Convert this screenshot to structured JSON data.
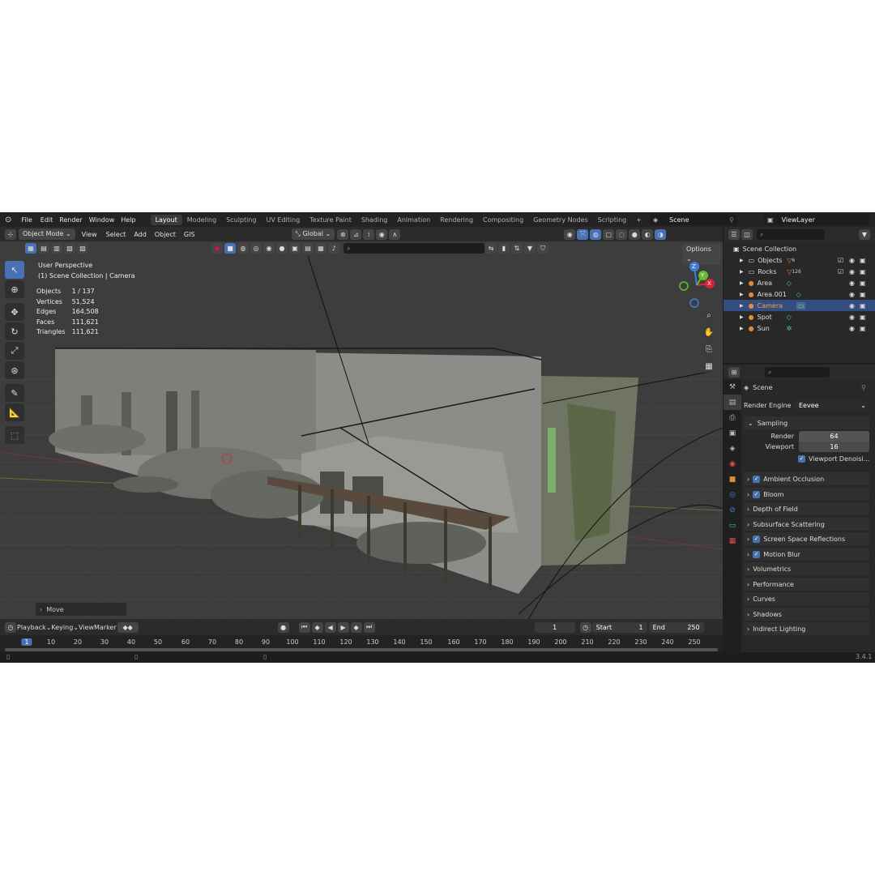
{
  "menus": [
    "File",
    "Edit",
    "Render",
    "Window",
    "Help"
  ],
  "workspaces": [
    "Layout",
    "Modeling",
    "Sculpting",
    "UV Editing",
    "Texture Paint",
    "Shading",
    "Animation",
    "Rendering",
    "Compositing",
    "Geometry Nodes",
    "Scripting"
  ],
  "active_workspace": "Layout",
  "add_workspace": "+",
  "scene_name": "Scene",
  "view_layer": "ViewLayer",
  "viewport_header": {
    "mode": "Object Mode",
    "menus": [
      "View",
      "Select",
      "Add",
      "Object",
      "GIS"
    ],
    "orientation": "Global",
    "options": "Options"
  },
  "viewport_overlay": {
    "perspective": "User Perspective",
    "collection": "(1) Scene Collection | Camera",
    "stats": [
      {
        "label": "Objects",
        "value": "1 / 137"
      },
      {
        "label": "Vertices",
        "value": "51,524"
      },
      {
        "label": "Edges",
        "value": "164,508"
      },
      {
        "label": "Faces",
        "value": "111,621"
      },
      {
        "label": "Triangles",
        "value": "111,621"
      }
    ],
    "last_op": "Move",
    "gizmo": {
      "z": "Z",
      "y": "Y",
      "x": "X"
    }
  },
  "timeline": {
    "menus": [
      "Playback",
      "Keying",
      "View",
      "Marker"
    ],
    "current_frame": "1",
    "start_label": "Start",
    "start": "1",
    "end_label": "End",
    "end": "250",
    "ruler_current": "1",
    "ruler": [
      "10",
      "20",
      "30",
      "40",
      "50",
      "60",
      "70",
      "80",
      "90",
      "100",
      "110",
      "120",
      "130",
      "140",
      "150",
      "160",
      "170",
      "180",
      "190",
      "200",
      "210",
      "220",
      "230",
      "240",
      "250"
    ]
  },
  "outliner": {
    "root": "Scene Collection",
    "items": [
      {
        "name": "Objects",
        "badge": "6",
        "checked": true,
        "selected": false
      },
      {
        "name": "Rocks",
        "badge": "126",
        "checked": true,
        "selected": false
      },
      {
        "name": "Area",
        "badge": "",
        "checked": false,
        "selected": false
      },
      {
        "name": "Area.001",
        "badge": "",
        "checked": false,
        "selected": false
      },
      {
        "name": "Camera",
        "badge": "",
        "checked": false,
        "selected": true
      },
      {
        "name": "Spot",
        "badge": "",
        "checked": false,
        "selected": false
      },
      {
        "name": "Sun",
        "badge": "",
        "checked": false,
        "selected": false
      }
    ]
  },
  "properties": {
    "title": "Scene",
    "render_engine_label": "Render Engine",
    "render_engine": "Eevee",
    "sampling": {
      "label": "Sampling",
      "render_label": "Render",
      "render": "64",
      "viewport_label": "Viewport",
      "viewport": "16",
      "denoise": "Viewport Denoisi..."
    },
    "panels": [
      {
        "label": "Ambient Occlusion",
        "checkbox": true
      },
      {
        "label": "Bloom",
        "checkbox": true
      },
      {
        "label": "Depth of Field",
        "checkbox": false
      },
      {
        "label": "Subsurface Scattering",
        "checkbox": false
      },
      {
        "label": "Screen Space Reflections",
        "checkbox": true
      },
      {
        "label": "Motion Blur",
        "checkbox": true
      },
      {
        "label": "Volumetrics",
        "checkbox": false
      },
      {
        "label": "Performance",
        "checkbox": false
      },
      {
        "label": "Curves",
        "checkbox": false
      },
      {
        "label": "Shadows",
        "checkbox": false
      },
      {
        "label": "Indirect Lighting",
        "checkbox": false
      }
    ]
  },
  "version": "3.4.1",
  "colors": {
    "accent": "#4772b3",
    "selected_row": "#334d80",
    "camera_text": "#f0a040"
  }
}
